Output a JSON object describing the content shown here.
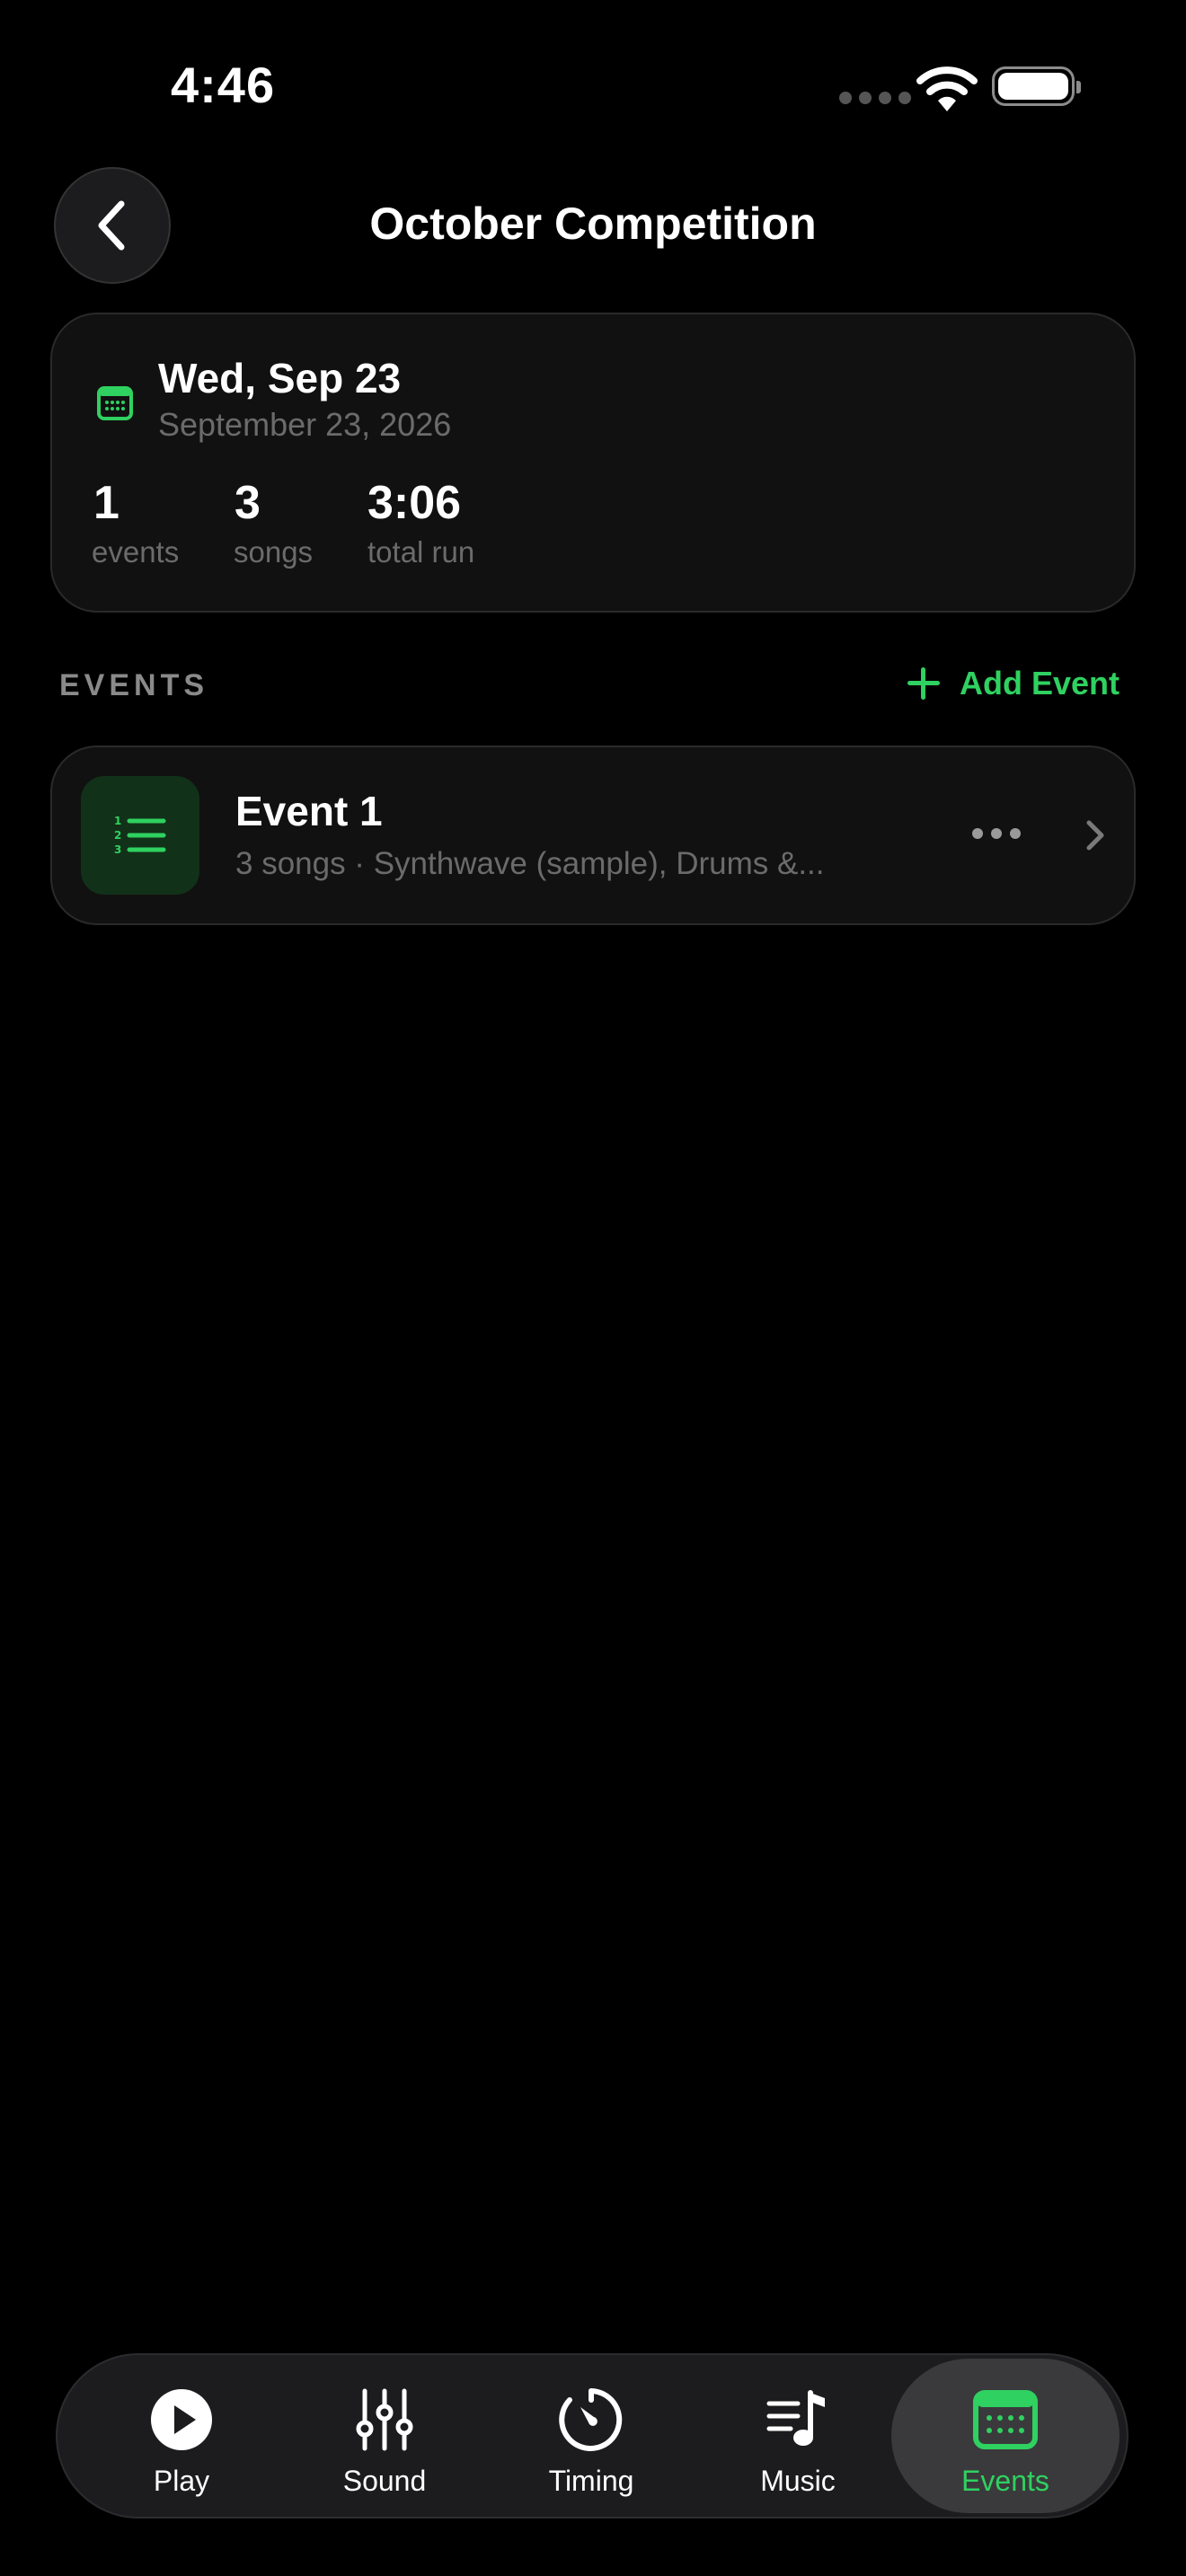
{
  "status_bar": {
    "time": "4:46"
  },
  "header": {
    "title": "October Competition"
  },
  "summary": {
    "date_main": "Wed, Sep 23",
    "date_sub": "September 23, 2026",
    "stats": [
      {
        "value": "1",
        "label": "events"
      },
      {
        "value": "3",
        "label": "songs"
      },
      {
        "value": "3:06",
        "label": "total run"
      }
    ]
  },
  "events_section": {
    "title": "EVENTS",
    "add_label": "Add Event",
    "items": [
      {
        "title": "Event 1",
        "subtitle": "3 songs · Synthwave (sample), Drums &..."
      }
    ]
  },
  "tab_bar": {
    "tabs": [
      {
        "label": "Play",
        "icon": "play-icon"
      },
      {
        "label": "Sound",
        "icon": "sliders-icon"
      },
      {
        "label": "Timing",
        "icon": "timer-icon"
      },
      {
        "label": "Music",
        "icon": "music-list-icon"
      },
      {
        "label": "Events",
        "icon": "calendar-icon",
        "active": true
      }
    ]
  },
  "colors": {
    "accent": "#2fd160",
    "background": "#000000",
    "card": "#111111"
  }
}
